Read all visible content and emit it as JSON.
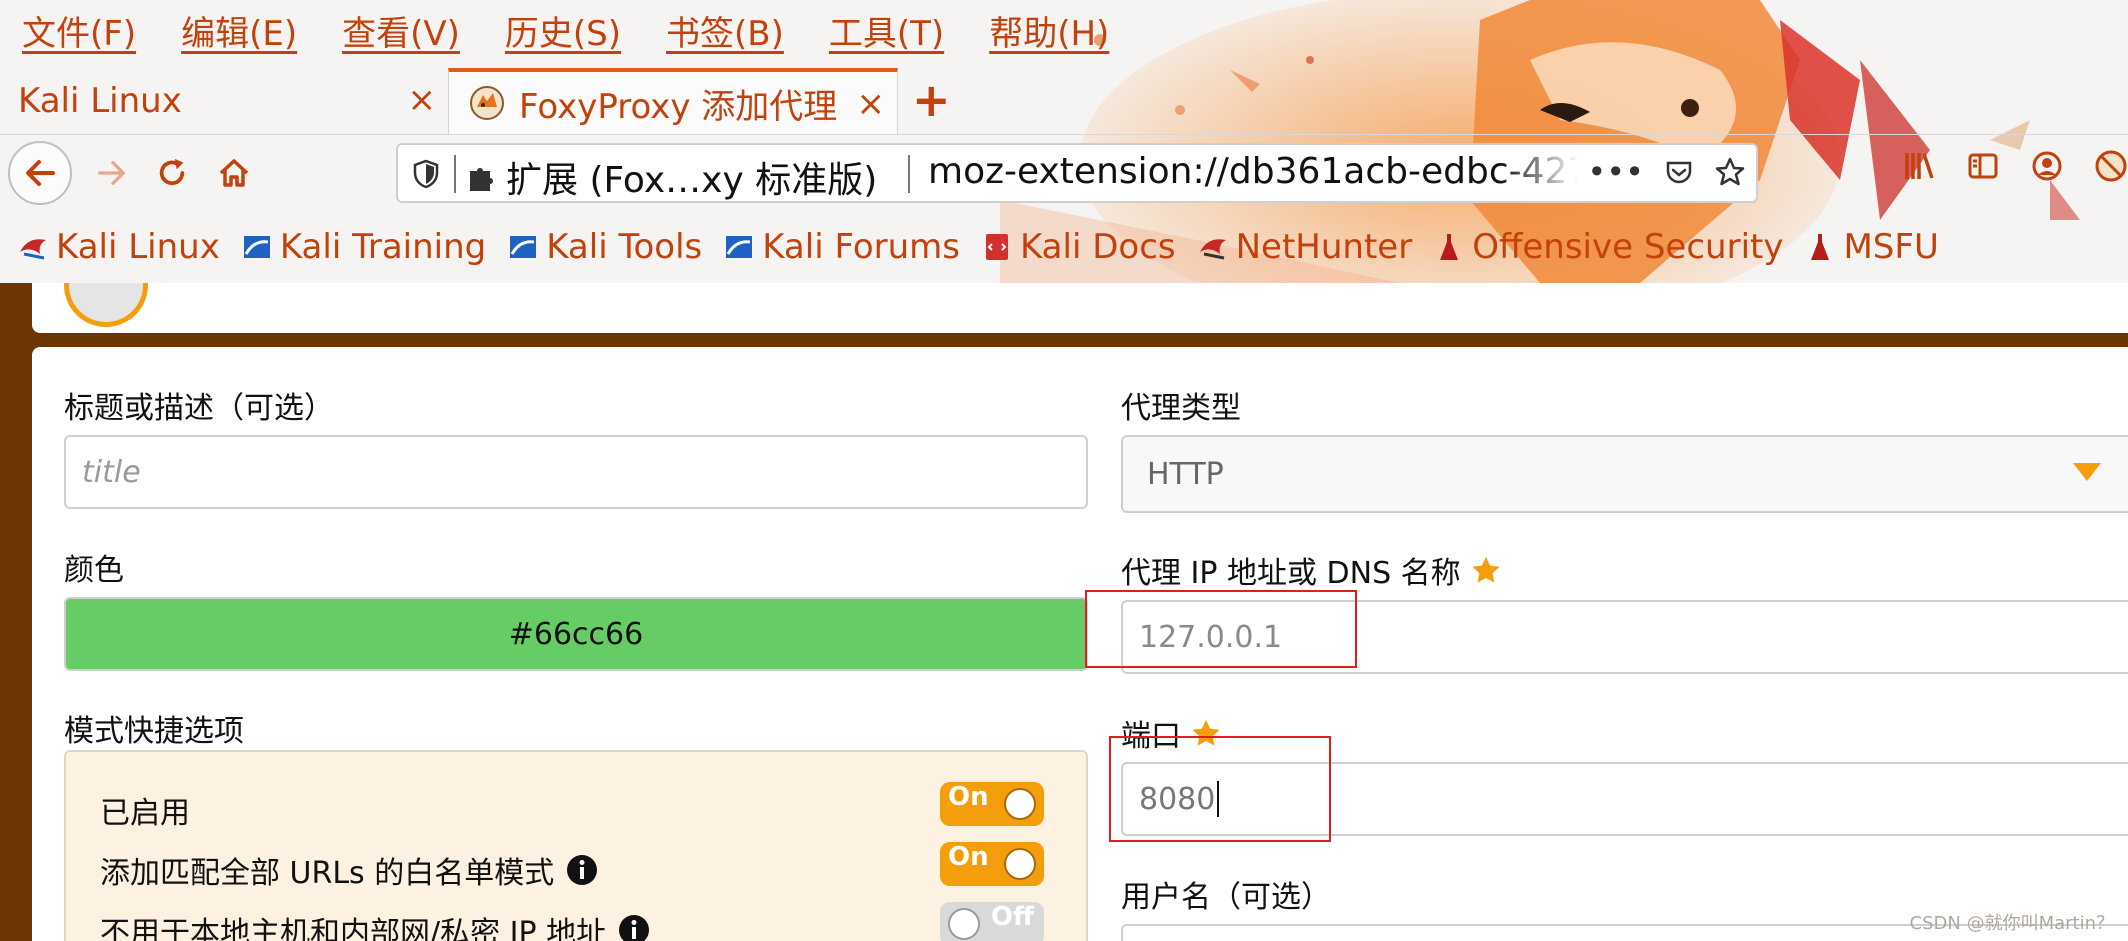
{
  "menubar": {
    "items": [
      "文件(F)",
      "编辑(E)",
      "查看(V)",
      "历史(S)",
      "书签(B)",
      "工具(T)",
      "帮助(H)"
    ]
  },
  "tabs": [
    {
      "label": "Kali Linux",
      "close": "×",
      "active": false
    },
    {
      "label": "FoxyProxy 添加代理",
      "close": "×",
      "active": true
    }
  ],
  "new_tab_label": "+",
  "urlbar": {
    "extension_label": "扩展 (Fox…xy 标准版)",
    "url": "moz-extension://db361acb-edbc-427",
    "more_glyph": "•••"
  },
  "bookmarks": [
    {
      "label": "Kali Linux",
      "icon": "kali-dragon-icon"
    },
    {
      "label": "Kali Training",
      "icon": "kali-training-icon"
    },
    {
      "label": "Kali Tools",
      "icon": "kali-tools-icon"
    },
    {
      "label": "Kali Forums",
      "icon": "kali-forums-icon"
    },
    {
      "label": "Kali Docs",
      "icon": "kali-docs-icon"
    },
    {
      "label": "NetHunter",
      "icon": "nethunter-icon"
    },
    {
      "label": "Offensive Security",
      "icon": "offsec-icon"
    },
    {
      "label": "MSFU",
      "icon": "msfu-icon"
    }
  ],
  "form": {
    "title_label": "标题或描述（可选）",
    "title_placeholder": "title",
    "color_label": "颜色",
    "color_value": "#66cc66",
    "pattern_label": "模式快捷选项",
    "options": [
      {
        "label": "已启用",
        "toggle": "On",
        "info": false
      },
      {
        "label": "添加匹配全部 URLs 的白名单模式",
        "toggle": "On",
        "info": true
      },
      {
        "label": "不用于本地主机和内部网/私密 IP 地址",
        "toggle": "Off",
        "info": true
      }
    ],
    "proxy_type_label": "代理类型",
    "proxy_type_value": "HTTP",
    "ip_label": "代理 IP 地址或 DNS 名称",
    "ip_value": "127.0.0.1",
    "port_label": "端口",
    "port_value": "8080",
    "username_label": "用户名（可选）"
  },
  "colors": {
    "accent": "#e25c12",
    "menu_text": "#c2410c",
    "page_bg": "#6b3506",
    "toggle_on": "#f59e0b",
    "swatch": "#66cc66",
    "highlight_box": "#e01e1e"
  },
  "watermark": "CSDN @就你叫Martin？"
}
